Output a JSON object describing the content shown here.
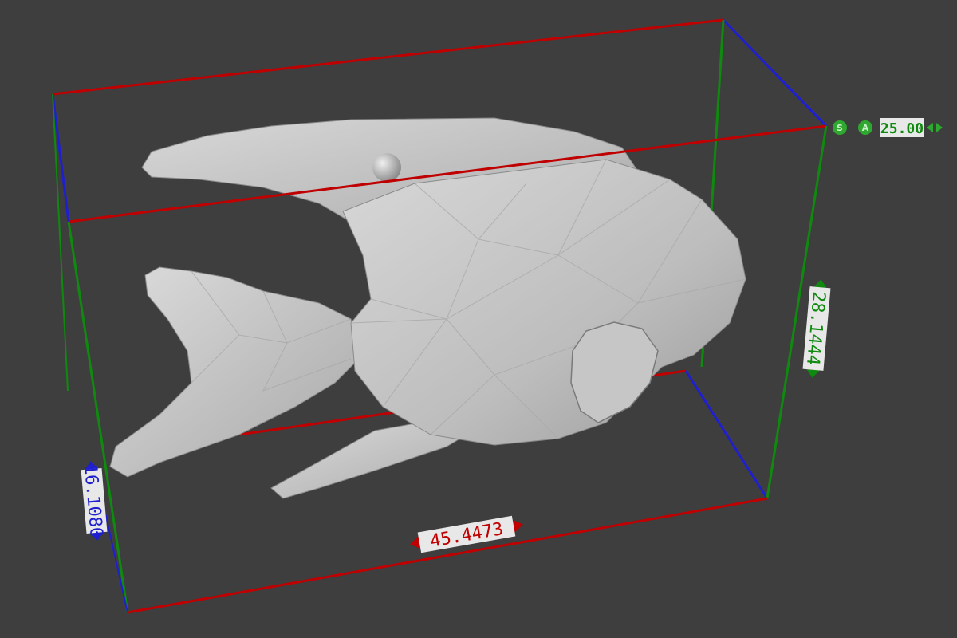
{
  "viewport": {
    "background": "#3e3e3e",
    "model_color": "#c8c8c8"
  },
  "bounding_box": {
    "x_color": "#c00000",
    "y_color": "#1f1fd0",
    "z_color": "#0f8a0f"
  },
  "dimensions": {
    "x_label": "45.4473",
    "y_label": "16.1080",
    "z_label": "28.1444"
  },
  "scale_widget": {
    "s_label": "S",
    "a_label": "A",
    "value": "25.00",
    "icons": [
      "s-circle-icon",
      "a-circle-icon",
      "arrow-left-icon",
      "arrow-right-icon"
    ]
  }
}
